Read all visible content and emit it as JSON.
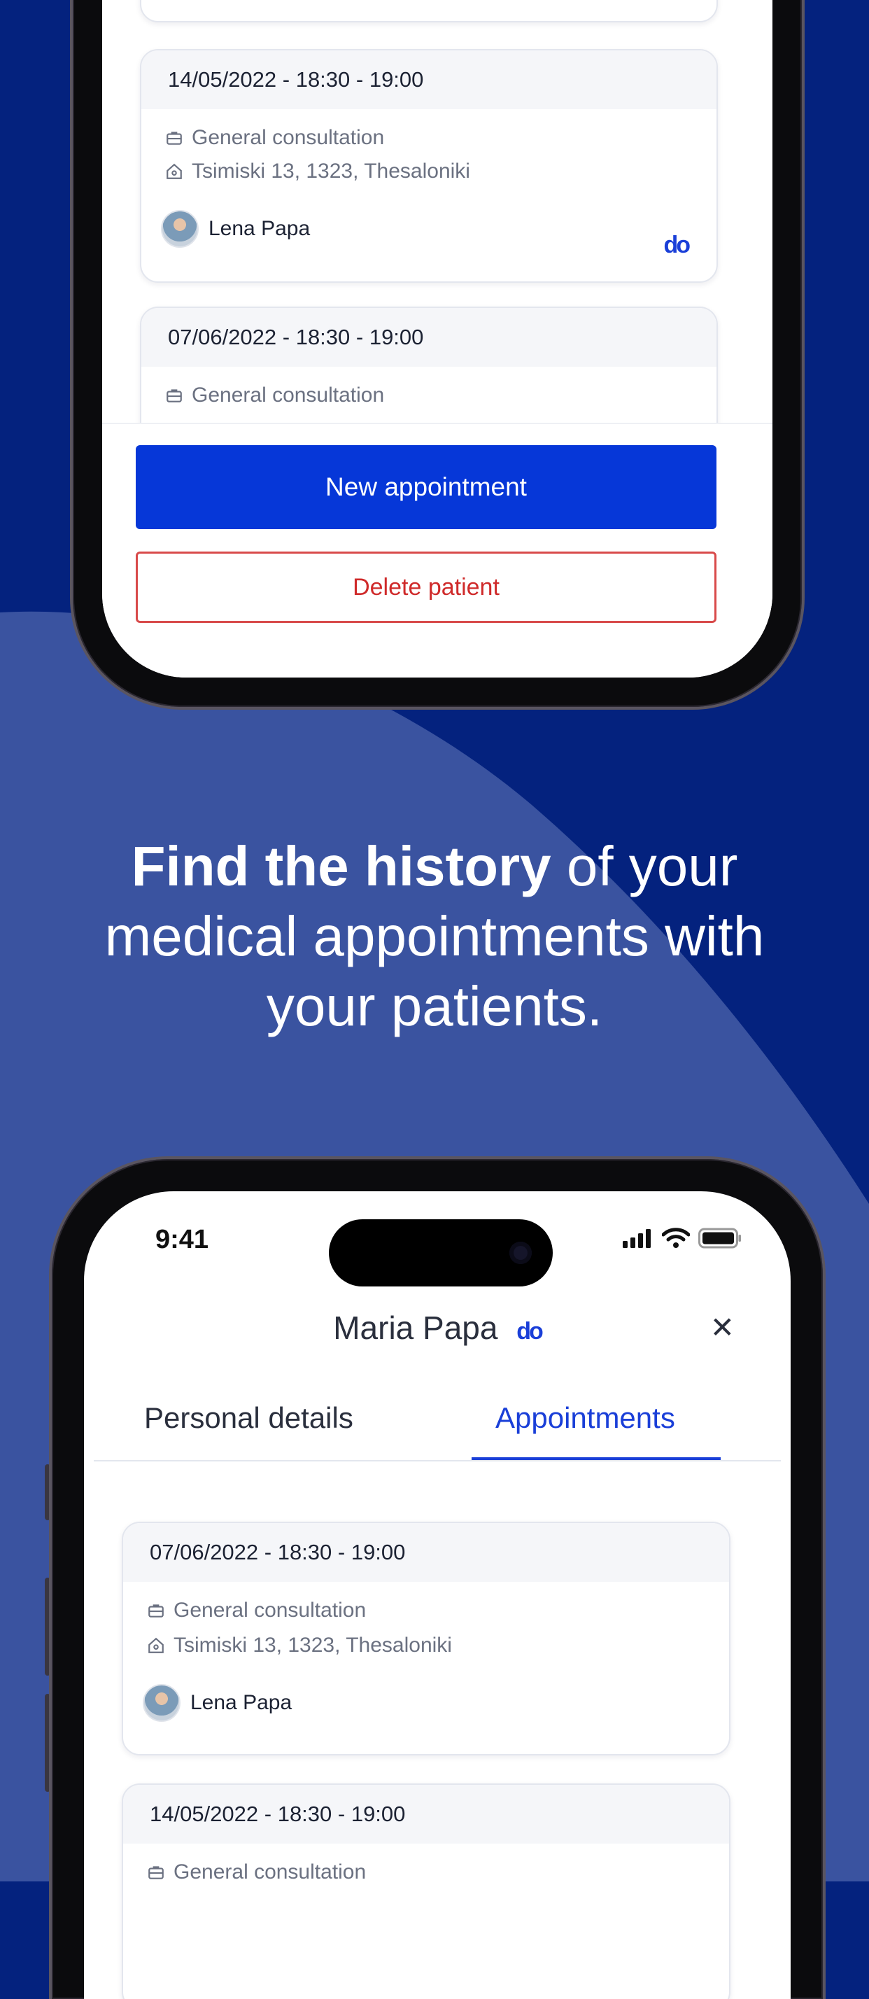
{
  "headline": {
    "bold": "Find the history",
    "rest_line1": " of your",
    "line2": "medical appointments with",
    "line3": "your patients."
  },
  "phone_top": {
    "cards": [
      {
        "datetime": "14/05/2022 - 18:30 - 19:00",
        "service": "General consultation",
        "address": "Tsimiski 13, 1323, Thesaloniki",
        "doctor": "Lena Papa"
      },
      {
        "datetime": "07/06/2022 - 18:30 - 19:00",
        "service": "General consultation"
      }
    ],
    "new_appointment_label": "New appointment",
    "delete_patient_label": "Delete patient"
  },
  "phone_bottom": {
    "status_time": "9:41",
    "patient_name": "Maria Papa",
    "tabs": [
      {
        "label": "Personal details",
        "active": false
      },
      {
        "label": "Appointments",
        "active": true
      }
    ],
    "cards": [
      {
        "datetime": "07/06/2022 - 18:30 - 19:00",
        "service": "General consultation",
        "address": "Tsimiski 13, 1323, Thesaloniki",
        "doctor": "Lena Papa"
      },
      {
        "datetime": "14/05/2022 - 18:30 - 19:00",
        "service": "General consultation"
      }
    ]
  },
  "brand_logo_text": "do",
  "colors": {
    "background_dark": "#04227E",
    "background_light": "#3A53A0",
    "primary_button": "#0637D8",
    "danger": "#CF2A2A",
    "accent": "#1A3FD8"
  },
  "icons": [
    "briefcase-icon",
    "home-icon",
    "avatar",
    "close-icon",
    "signal-icon",
    "wifi-icon",
    "battery-icon",
    "brand-logo"
  ]
}
